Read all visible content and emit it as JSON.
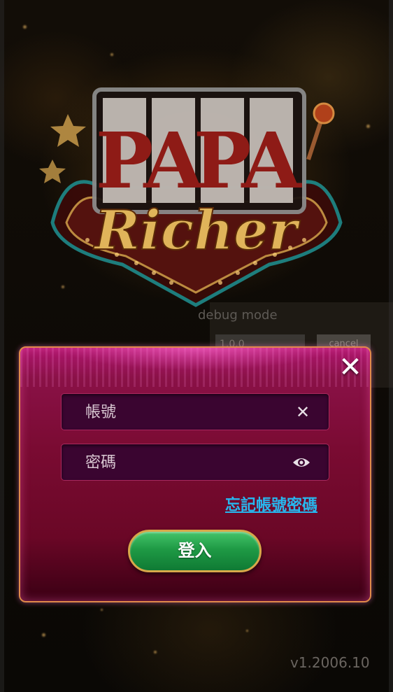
{
  "logo": {
    "line1_letters": [
      "P",
      "A",
      "P",
      "A"
    ],
    "line2": "Richer"
  },
  "debug": {
    "label": "debug mode",
    "version_value": "1.0.0",
    "cancel_label": "cancel"
  },
  "login_dialog": {
    "close_icon": "close-icon",
    "username_placeholder": "帳號",
    "username_clear_icon": "clear-icon",
    "password_placeholder": "密碼",
    "password_toggle_icon": "eye-icon",
    "forgot_link": "忘記帳號密碼",
    "login_button": "登入"
  },
  "app_version": "v1.2006.10",
  "colors": {
    "dialog_top": "#b0176f",
    "dialog_bottom": "#3a0014",
    "dialog_border": "#e08a4a",
    "button_green": "#1f9a45",
    "link_blue": "#27b7ee"
  }
}
